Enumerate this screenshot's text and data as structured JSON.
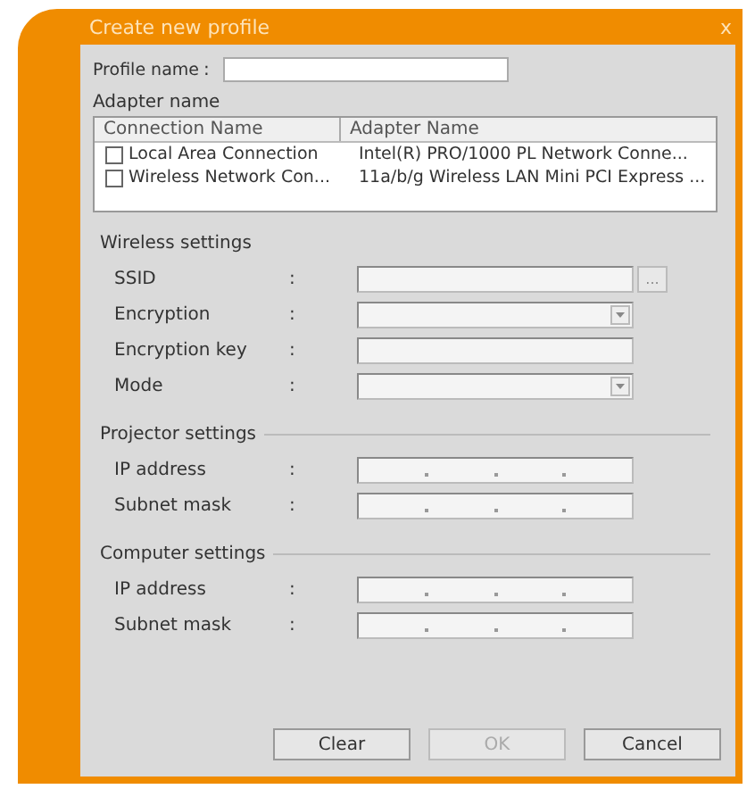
{
  "window": {
    "title": "Create new profile",
    "close": "x"
  },
  "profile_name": {
    "label": "Profile name",
    "colon": ":"
  },
  "adapter": {
    "label": "Adapter name",
    "columns": [
      "Connection Name",
      "Adapter Name"
    ],
    "rows": [
      {
        "connection": "Local Area Connection",
        "adapter": "Intel(R) PRO/1000 PL Network Conne...",
        "checked": false
      },
      {
        "connection": "Wireless Network Con...",
        "adapter": "11a/b/g Wireless LAN Mini PCI Express ...",
        "checked": false
      }
    ]
  },
  "sections": [
    {
      "title": "Wireless settings",
      "divider": false,
      "fields": [
        {
          "label": "SSID",
          "kind": "browse",
          "button": "..."
        },
        {
          "label": "Encryption",
          "kind": "dropdown"
        },
        {
          "label": "Encryption key",
          "kind": "text"
        },
        {
          "label": "Mode",
          "kind": "dropdown"
        }
      ]
    },
    {
      "title": "Projector settings",
      "divider": true,
      "fields": [
        {
          "label": "IP address",
          "kind": "ip"
        },
        {
          "label": "Subnet mask",
          "kind": "ip"
        }
      ]
    },
    {
      "title": "Computer settings",
      "divider": true,
      "fields": [
        {
          "label": "IP address",
          "kind": "ip"
        },
        {
          "label": "Subnet mask",
          "kind": "ip"
        }
      ]
    }
  ],
  "field_colon": ":",
  "buttons": [
    {
      "label": "Clear",
      "disabled": false
    },
    {
      "label": "OK",
      "disabled": true
    },
    {
      "label": "Cancel",
      "disabled": false
    }
  ]
}
